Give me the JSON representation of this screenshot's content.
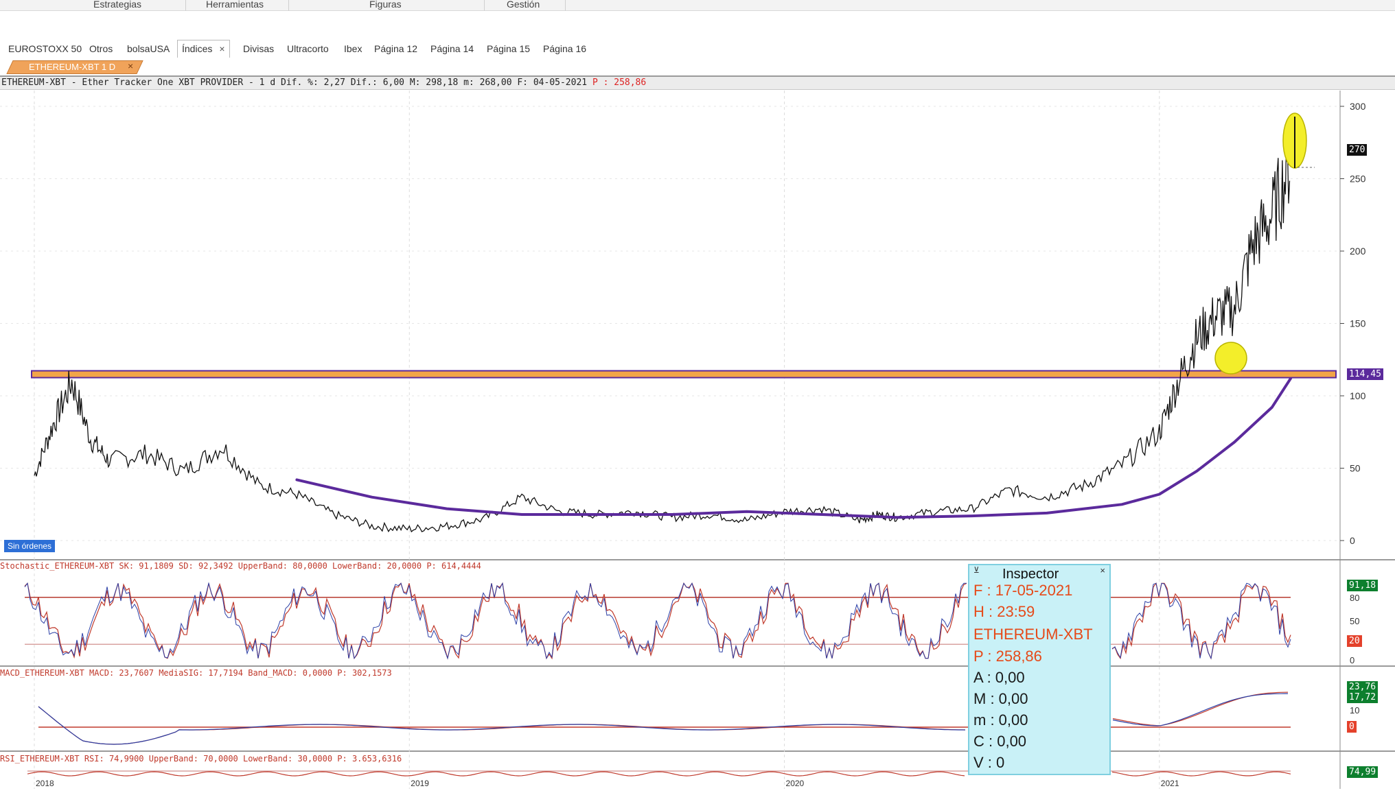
{
  "topmenu": [
    "Estrategias",
    "Herramientas",
    "Figuras",
    "Gestión"
  ],
  "tabs": [
    {
      "label": "EUROSTOXX 50",
      "active": false
    },
    {
      "label": "Otros",
      "active": false
    },
    {
      "label": "bolsaUSA",
      "active": false
    },
    {
      "label": "Índices",
      "active": true
    },
    {
      "label": "Divisas",
      "active": false
    },
    {
      "label": "Ultracorto",
      "active": false
    },
    {
      "label": "Ibex",
      "active": false
    },
    {
      "label": "Página 12",
      "active": false
    },
    {
      "label": "Página 14",
      "active": false
    },
    {
      "label": "Página 15",
      "active": false
    },
    {
      "label": "Página 16",
      "active": false
    }
  ],
  "tab_close": "×",
  "doc_tab": {
    "label": "ETHEREUM-XBT 1 D",
    "close": "×"
  },
  "info_bar": {
    "text": "ETHEREUM-XBT - Ether Tracker One XBT PROVIDER -  1 d Dif. %: 2,27 Dif.: 6,00 M: 298,18 m: 268,00 F: 04-05-2021",
    "price": "P : 258,86"
  },
  "badges": {
    "sin_ordenes": "Sin órdenes"
  },
  "indicators": {
    "stochastic": "Stochastic_ETHEREUM-XBT SK: 91,1809 SD: 92,3492 UpperBand: 80,0000 LowerBand: 20,0000 P: 614,4444",
    "macd": "MACD_ETHEREUM-XBT MACD: 23,7607 MediaSIG: 17,7194 Band_MACD: 0,0000 P: 302,1573",
    "rsi": "RSI_ETHEREUM-XBT RSI: 74,9900 UpperBand: 70,0000 LowerBand: 30,0000 P: 3.653,6316"
  },
  "inspector": {
    "title": "Inspector",
    "close": "×",
    "pin": "⊻",
    "date": "F : 17-05-2021",
    "hour": "H : 23:59",
    "symbol": "ETHEREUM-XBT",
    "price": "P : 258,86",
    "a": "A : 0,00",
    "m_upper": "M : 0,00",
    "m_lower": "m : 0,00",
    "c": "C : 0,00",
    "v": "V : 0"
  },
  "price_axis": {
    "ticks": [
      "300",
      "250",
      "200",
      "150",
      "100",
      "50",
      "0"
    ],
    "current_price_box": "270",
    "level_box": "114,45"
  },
  "stoch_axis": {
    "ticks": [
      "80",
      "50",
      "0"
    ],
    "value_box": "91,18",
    "low_box": "20"
  },
  "macd_axis": {
    "ticks": [
      "10",
      "0"
    ],
    "value_box_1": "23,76",
    "value_box_2": "17,72",
    "zero_box": "0"
  },
  "rsi_axis": {
    "value_box": "74,99"
  },
  "x_axis_labels": [
    "2018",
    "2019",
    "2020",
    "2021"
  ],
  "colors": {
    "candles": "#111111",
    "moving_average": "#5b2a9c",
    "resistance_line": "#d4551a",
    "highlight": "#f3ee2a",
    "stoch_line_1": "#c0392b",
    "stoch_line_2": "#2b3fa6",
    "band": "#d9a3a0",
    "panel_border": "#9a9a9a"
  },
  "chart_data": {
    "type": "line",
    "title": "ETHEREUM-XBT",
    "xlabel": "",
    "ylabel": "",
    "x_range": [
      "2018",
      "2021"
    ],
    "ylim": [
      0,
      300
    ],
    "grid": true,
    "legend_position": "none",
    "horizontal_level": 114.45,
    "current_price_marker": 270,
    "series": [
      {
        "name": "ETHEREUM-XBT",
        "x": [
          2018.0,
          2018.05,
          2018.1,
          2018.15,
          2018.2,
          2018.3,
          2018.4,
          2018.5,
          2018.6,
          2018.7,
          2018.8,
          2018.9,
          2019.0,
          2019.1,
          2019.2,
          2019.3,
          2019.4,
          2019.5,
          2019.6,
          2019.7,
          2019.8,
          2019.9,
          2020.0,
          2020.1,
          2020.2,
          2020.25,
          2020.3,
          2020.4,
          2020.5,
          2020.6,
          2020.7,
          2020.8,
          2020.9,
          2021.0,
          2021.05,
          2021.1,
          2021.15,
          2021.2,
          2021.25,
          2021.3,
          2021.35
        ],
        "y": [
          45,
          80,
          110,
          70,
          55,
          60,
          48,
          65,
          38,
          32,
          18,
          10,
          8,
          10,
          15,
          30,
          20,
          18,
          20,
          16,
          18,
          14,
          20,
          22,
          14,
          18,
          16,
          20,
          22,
          35,
          30,
          38,
          52,
          75,
          110,
          140,
          155,
          160,
          205,
          225,
          262
        ]
      },
      {
        "name": "",
        "x": [
          2018.7,
          2018.9,
          2019.1,
          2019.3,
          2019.5,
          2019.7,
          2019.9,
          2020.1,
          2020.3,
          2020.5,
          2020.7,
          2020.9,
          2021.0,
          2021.1,
          2021.2,
          2021.3,
          2021.35
        ],
        "y": [
          42,
          30,
          22,
          18,
          18,
          18,
          20,
          18,
          16,
          17,
          19,
          25,
          32,
          48,
          68,
          92,
          112
        ]
      }
    ]
  }
}
